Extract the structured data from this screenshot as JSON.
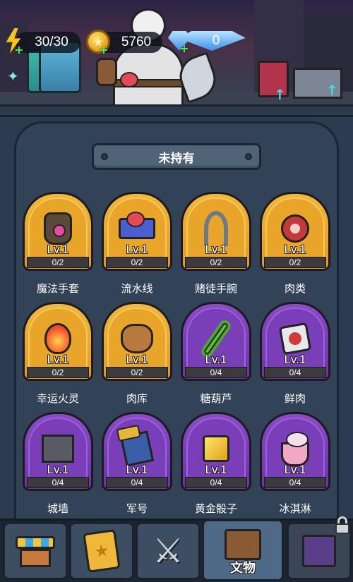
{
  "resources": {
    "energy": {
      "value": "30/30",
      "icon": "lightning-bolt-icon"
    },
    "gold": {
      "value": "5760",
      "icon": "gold-coin-icon"
    },
    "gems": {
      "value": "0",
      "icon": "diamond-icon"
    }
  },
  "collection": {
    "title": "未持有",
    "items": [
      {
        "name": "魔法手套",
        "level": "Lv.1",
        "progress": "0/2",
        "rarity": "gold",
        "icon": "magic-glove-icon"
      },
      {
        "name": "流水线",
        "level": "Lv.1",
        "progress": "0/2",
        "rarity": "gold",
        "icon": "conveyor-belt-icon"
      },
      {
        "name": "赌徒手腕",
        "level": "Lv.1",
        "progress": "0/2",
        "rarity": "gold",
        "icon": "hook-hand-icon"
      },
      {
        "name": "肉类",
        "level": "Lv.1",
        "progress": "0/2",
        "rarity": "gold",
        "icon": "meat-icon"
      },
      {
        "name": "幸运火灵",
        "level": "Lv.1",
        "progress": "0/2",
        "rarity": "gold",
        "icon": "fire-spirit-icon"
      },
      {
        "name": "肉库",
        "level": "Lv.1",
        "progress": "0/2",
        "rarity": "gold",
        "icon": "meat-sack-icon"
      },
      {
        "name": "糖葫芦",
        "level": "Lv.1",
        "progress": "0/4",
        "rarity": "purple",
        "icon": "candied-skewer-icon"
      },
      {
        "name": "鲜肉",
        "level": "Lv.1",
        "progress": "0/4",
        "rarity": "purple",
        "icon": "fresh-meat-icon"
      },
      {
        "name": "城墙",
        "level": "Lv.1",
        "progress": "0/4",
        "rarity": "purple",
        "icon": "city-wall-icon"
      },
      {
        "name": "军号",
        "level": "Lv.1",
        "progress": "0/4",
        "rarity": "purple",
        "icon": "bugle-icon"
      },
      {
        "name": "黄金骰子",
        "level": "Lv.1",
        "progress": "0/4",
        "rarity": "purple",
        "icon": "golden-dice-icon"
      },
      {
        "name": "冰淇淋",
        "level": "Lv.1",
        "progress": "0/4",
        "rarity": "purple",
        "icon": "ice-cream-icon"
      }
    ]
  },
  "nav": {
    "tabs": [
      {
        "id": "shop",
        "icon": "shop-icon"
      },
      {
        "id": "cards",
        "icon": "cards-icon"
      },
      {
        "id": "battle",
        "icon": "crossed-swords-icon"
      },
      {
        "id": "relics",
        "label": "文物",
        "icon": "book-icon",
        "active": true
      },
      {
        "id": "locked",
        "icon": "locked-item-icon",
        "locked": true
      }
    ]
  },
  "colors": {
    "gold_card": "#e8a52a",
    "purple_card": "#7a3fb8",
    "panel": "#324257"
  }
}
